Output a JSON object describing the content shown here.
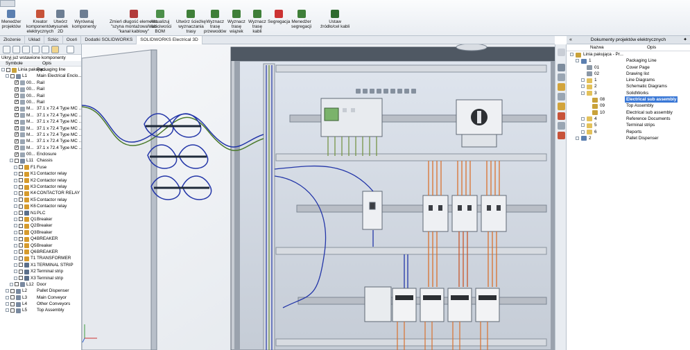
{
  "ribbon": {
    "tools": [
      {
        "label": "Menedżer\nprojektów",
        "icon": "project-manager-icon",
        "color": "#5b7fb0"
      },
      {
        "label": "Kreator\nkomponentów\nelektrycznych",
        "icon": "component-wizard-icon",
        "color": "#c7533a"
      },
      {
        "label": "Utwórz\nrysunek\n2D",
        "icon": "drawing-2d-icon",
        "color": "#6d7e93"
      },
      {
        "label": "Wyrównaj\nkomponenty",
        "icon": "align-components-icon",
        "color": "#6d7e93"
      },
      {
        "label": "Zmień długość elementu\n\"szyna montażowa\" lub\n\"kanał kablowy\"",
        "icon": "change-length-icon",
        "color": "#b23b3b"
      },
      {
        "label": "Aktualizuj\nwłaściwości\nBOM",
        "icon": "update-bom-icon",
        "color": "#4c8f4a"
      },
      {
        "label": "Utwórz ścieżkę\nwyznaczania\ntrasy",
        "icon": "create-route-path-icon",
        "color": "#3f7f39"
      },
      {
        "label": "Wyznacz\ntrasę\nprzewodów",
        "icon": "route-wires-icon",
        "color": "#3f7f39"
      },
      {
        "label": "Wyznacz\ntrasę\nwiązek",
        "icon": "route-harness-icon",
        "color": "#3f7f39"
      },
      {
        "label": "Wyznacz\ntrasę\nkabli",
        "icon": "route-cables-icon",
        "color": "#3f7f39"
      },
      {
        "label": "Segregacja",
        "icon": "segregation-icon",
        "color": "#cc3333"
      },
      {
        "label": "Menedżer\nsegregacji",
        "icon": "segregation-manager-icon",
        "color": "#3f7f39"
      },
      {
        "label": "Ustaw\nźródło/cel kabli",
        "icon": "set-cable-source-icon",
        "color": "#2f6b2f"
      }
    ]
  },
  "tabs": [
    "Złożenie",
    "Układ",
    "Szkic",
    "Oceń",
    "Dodatki SOLIDWORKS",
    "SOLIDWORKS Electrical 3D"
  ],
  "active_tab": "SOLIDWORKS Electrical 3D",
  "left": {
    "hint": "Ukryj już wstawione komponenty",
    "col_symbol": "Symbole",
    "col_desc": "Opis",
    "rows": [
      {
        "lvl": 0,
        "exp": "-",
        "cb": false,
        "tag": "Linia pakując...",
        "desc": "Packaging line",
        "ic": "#c9a23a"
      },
      {
        "lvl": 1,
        "exp": "-",
        "cb": false,
        "tag": "L1",
        "desc": "Main Electrical Enclo...",
        "ic": "#7a8aa0"
      },
      {
        "lvl": 2,
        "exp": "",
        "cb": true,
        "tag": "00...",
        "desc": "Rail",
        "ic": "#9aa6b3"
      },
      {
        "lvl": 2,
        "exp": "",
        "cb": true,
        "tag": "00...",
        "desc": "Rail",
        "ic": "#9aa6b3"
      },
      {
        "lvl": 2,
        "exp": "",
        "cb": true,
        "tag": "00...",
        "desc": "Rail",
        "ic": "#9aa6b3"
      },
      {
        "lvl": 2,
        "exp": "",
        "cb": true,
        "tag": "00...",
        "desc": "Rail",
        "ic": "#9aa6b3"
      },
      {
        "lvl": 2,
        "exp": "",
        "cb": true,
        "tag": "M...",
        "desc": "37.1 x 72.4 Type MC ...",
        "ic": "#9aa6b3"
      },
      {
        "lvl": 2,
        "exp": "",
        "cb": true,
        "tag": "M...",
        "desc": "37.1 x 72.4 Type MC ...",
        "ic": "#9aa6b3"
      },
      {
        "lvl": 2,
        "exp": "",
        "cb": true,
        "tag": "M...",
        "desc": "37.1 x 72.4 Type MC ...",
        "ic": "#9aa6b3"
      },
      {
        "lvl": 2,
        "exp": "",
        "cb": true,
        "tag": "M...",
        "desc": "37.1 x 72.4 Type MC ...",
        "ic": "#9aa6b3"
      },
      {
        "lvl": 2,
        "exp": "",
        "cb": true,
        "tag": "M...",
        "desc": "37.1 x 72.4 Type MC ...",
        "ic": "#9aa6b3"
      },
      {
        "lvl": 2,
        "exp": "",
        "cb": true,
        "tag": "M...",
        "desc": "37.1 x 72.4 Type MC ...",
        "ic": "#9aa6b3"
      },
      {
        "lvl": 2,
        "exp": "",
        "cb": true,
        "tag": "M...",
        "desc": "37.1 x 72.4 Type MC ...",
        "ic": "#9aa6b3"
      },
      {
        "lvl": 2,
        "exp": "",
        "cb": true,
        "tag": "00...",
        "desc": "Enclosure",
        "ic": "#9aa6b3"
      },
      {
        "lvl": 2,
        "exp": "-",
        "cb": false,
        "tag": "L11",
        "desc": "Chassis",
        "ic": "#7a8aa0"
      },
      {
        "lvl": 3,
        "exp": "+",
        "cb": false,
        "tag": "F1",
        "desc": "Fuse",
        "ic": "#d69b2d"
      },
      {
        "lvl": 3,
        "exp": "+",
        "cb": false,
        "tag": "K1",
        "desc": "Contactor relay",
        "ic": "#d69b2d"
      },
      {
        "lvl": 3,
        "exp": "+",
        "cb": false,
        "tag": "K2",
        "desc": "Contactor relay",
        "ic": "#d69b2d"
      },
      {
        "lvl": 3,
        "exp": "+",
        "cb": false,
        "tag": "K3",
        "desc": "Contactor relay",
        "ic": "#d69b2d"
      },
      {
        "lvl": 3,
        "exp": "+",
        "cb": false,
        "tag": "K4",
        "desc": "CONTACTOR RELAY",
        "ic": "#d69b2d"
      },
      {
        "lvl": 3,
        "exp": "+",
        "cb": false,
        "tag": "K5",
        "desc": "Contactor relay",
        "ic": "#d69b2d"
      },
      {
        "lvl": 3,
        "exp": "+",
        "cb": false,
        "tag": "K6",
        "desc": "Contactor relay",
        "ic": "#d69b2d"
      },
      {
        "lvl": 3,
        "exp": "+",
        "cb": false,
        "tag": "N1",
        "desc": "PLC",
        "ic": "#5b6f8a"
      },
      {
        "lvl": 3,
        "exp": "+",
        "cb": false,
        "tag": "Q1",
        "desc": "Breaker",
        "ic": "#d69b2d"
      },
      {
        "lvl": 3,
        "exp": "+",
        "cb": false,
        "tag": "Q2",
        "desc": "Breaker",
        "ic": "#d69b2d"
      },
      {
        "lvl": 3,
        "exp": "+",
        "cb": false,
        "tag": "Q3",
        "desc": "Breaker",
        "ic": "#d69b2d"
      },
      {
        "lvl": 3,
        "exp": "+",
        "cb": false,
        "tag": "Q4",
        "desc": "BREAKER",
        "ic": "#d69b2d"
      },
      {
        "lvl": 3,
        "exp": "+",
        "cb": false,
        "tag": "Q5",
        "desc": "Breaker",
        "ic": "#d69b2d"
      },
      {
        "lvl": 3,
        "exp": "+",
        "cb": false,
        "tag": "Q6",
        "desc": "BREAKER",
        "ic": "#d69b2d"
      },
      {
        "lvl": 3,
        "exp": "+",
        "cb": false,
        "tag": "T1",
        "desc": "TRANSFORMER",
        "ic": "#d69b2d"
      },
      {
        "lvl": 3,
        "exp": "+",
        "cb": false,
        "tag": "X1",
        "desc": "TERMINAL STRIP",
        "ic": "#5b6f8a"
      },
      {
        "lvl": 3,
        "exp": "+",
        "cb": false,
        "tag": "X2",
        "desc": "Terminal strip",
        "ic": "#5b6f8a"
      },
      {
        "lvl": 3,
        "exp": "+",
        "cb": false,
        "tag": "X3",
        "desc": "Terminal strip",
        "ic": "#5b6f8a"
      },
      {
        "lvl": 2,
        "exp": "+",
        "cb": false,
        "tag": "L12",
        "desc": "Door",
        "ic": "#7a8aa0"
      },
      {
        "lvl": 1,
        "exp": "+",
        "cb": false,
        "tag": "L2",
        "desc": "Pallet Dispenser",
        "ic": "#7a8aa0"
      },
      {
        "lvl": 1,
        "exp": "+",
        "cb": false,
        "tag": "L3",
        "desc": "Main Conveyor",
        "ic": "#7a8aa0"
      },
      {
        "lvl": 1,
        "exp": "+",
        "cb": false,
        "tag": "L4",
        "desc": "Other Conveyors",
        "ic": "#7a8aa0"
      },
      {
        "lvl": 1,
        "exp": "+",
        "cb": false,
        "tag": "L5",
        "desc": "Top Assembly",
        "ic": "#7a8aa0"
      }
    ]
  },
  "right": {
    "title": "Dokumenty projektów elektrycznych",
    "col_name": "Nazwa",
    "col_desc": "Opis",
    "rows": [
      {
        "lvl": 0,
        "exp": "-",
        "num": "Linia pakująca - Pr...",
        "desc": "",
        "ic": "#c9a23a",
        "sel": false
      },
      {
        "lvl": 1,
        "exp": "-",
        "num": "1",
        "desc": "Packaging Line",
        "ic": "#5b7fb0",
        "sel": false
      },
      {
        "lvl": 2,
        "exp": "",
        "num": "01",
        "desc": "Cover Page",
        "ic": "#8b98a6",
        "sel": false
      },
      {
        "lvl": 2,
        "exp": "",
        "num": "02",
        "desc": "Drawing list",
        "ic": "#8b98a6",
        "sel": false
      },
      {
        "lvl": 2,
        "exp": "+",
        "num": "1",
        "desc": "Line Diagrams",
        "ic": "#e3c15a",
        "sel": false
      },
      {
        "lvl": 2,
        "exp": "+",
        "num": "2",
        "desc": "Schematic Diagrams",
        "ic": "#e3c15a",
        "sel": false
      },
      {
        "lvl": 2,
        "exp": "-",
        "num": "3",
        "desc": "SolidWorks",
        "ic": "#e3c15a",
        "sel": false
      },
      {
        "lvl": 3,
        "exp": "",
        "num": "08",
        "desc": "Electrical sub assembly",
        "ic": "#c9a23a",
        "sel": true
      },
      {
        "lvl": 3,
        "exp": "",
        "num": "09",
        "desc": "Top Assembly",
        "ic": "#c9a23a",
        "sel": false
      },
      {
        "lvl": 3,
        "exp": "",
        "num": "10",
        "desc": "Electrical sub assembly",
        "ic": "#c9a23a",
        "sel": false
      },
      {
        "lvl": 2,
        "exp": "+",
        "num": "4",
        "desc": "Reference Documents",
        "ic": "#e3c15a",
        "sel": false
      },
      {
        "lvl": 2,
        "exp": "+",
        "num": "5",
        "desc": "Terminal strips",
        "ic": "#e3c15a",
        "sel": false
      },
      {
        "lvl": 2,
        "exp": "+",
        "num": "6",
        "desc": "Reports",
        "ic": "#e3c15a",
        "sel": false
      },
      {
        "lvl": 1,
        "exp": "+",
        "num": "2",
        "desc": "Pallet Dispenser",
        "ic": "#5b7fb0",
        "sel": false
      }
    ]
  },
  "colors": {
    "selection": "#3a78d6",
    "wire_blue": "#2336a8",
    "wire_orange": "#d9712e",
    "wire_green": "#6e8f3a",
    "din_rail": "#b9bec6"
  }
}
